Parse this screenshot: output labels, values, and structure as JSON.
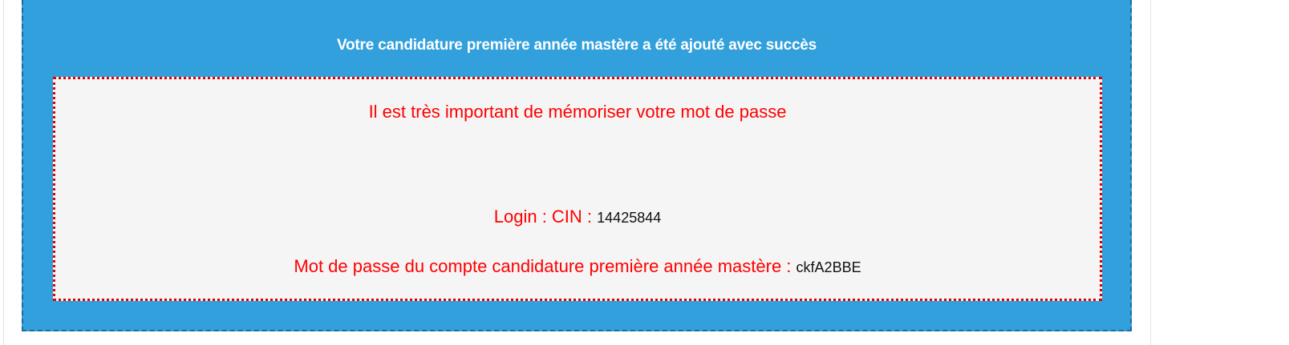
{
  "success": {
    "title": "Votre candidature première année mastère a été ajouté avec succès",
    "background_color": "#32a0dc"
  },
  "notice": {
    "warning": "Il est très important de mémoriser votre mot de passe",
    "login_label": "Login : CIN :",
    "login_value": "14425844",
    "password_label": "Mot de passe du compte candidature première année mastère :",
    "password_value": "ckfA2BBE",
    "label_color": "#ff0000",
    "border_color": "#e00000"
  }
}
